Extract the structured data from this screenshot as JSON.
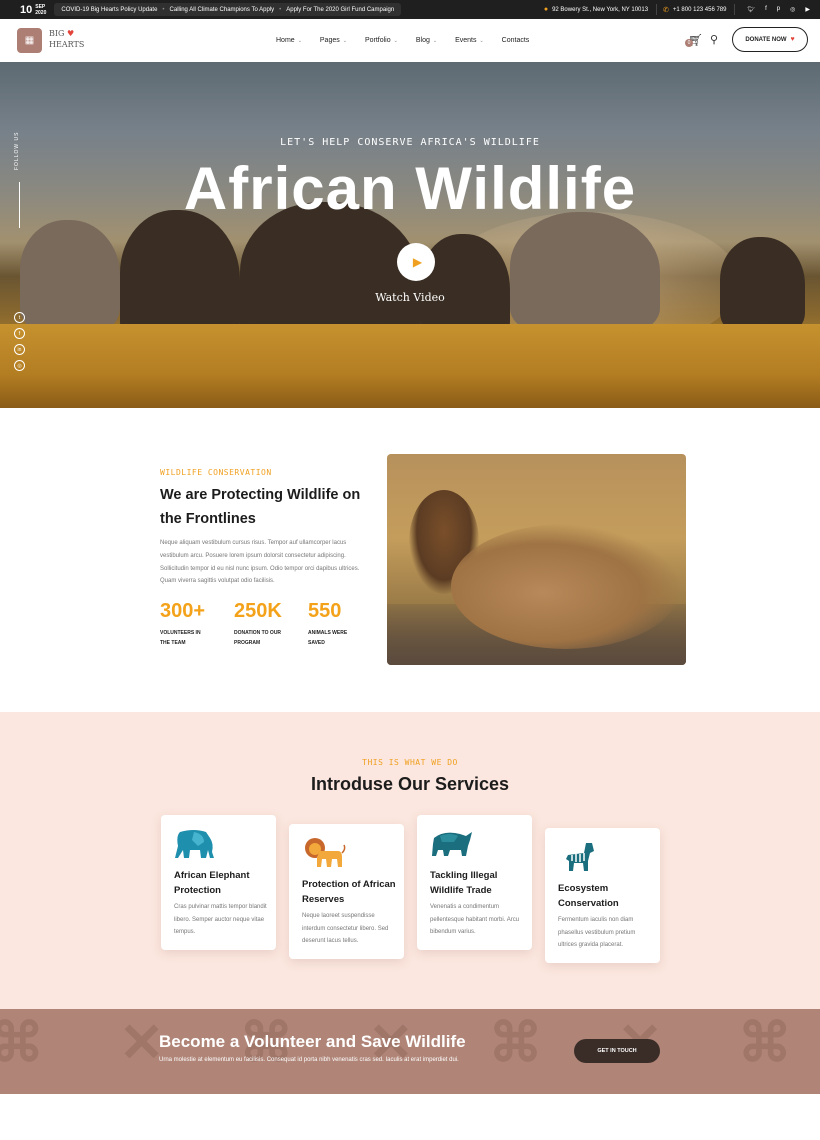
{
  "topbar": {
    "date_day": "10",
    "date_month": "SEP",
    "date_year": "2020",
    "news": [
      "COVID-19 Big Hearts Policy Update",
      "Calling All Climate Champions To Apply",
      "Apply For The 2020 Girl Fund Campaign"
    ],
    "address": "92 Bowery St., New York, NY 10013",
    "phone": "+1 800 123 456 789",
    "social_icons": [
      "twitter-icon",
      "facebook-icon",
      "pinterest-icon",
      "instagram-icon",
      "youtube-icon"
    ]
  },
  "header": {
    "logo_line1": "BIG",
    "logo_line2": "HEARTS",
    "nav": [
      {
        "label": "Home",
        "has_dropdown": true
      },
      {
        "label": "Pages",
        "has_dropdown": true
      },
      {
        "label": "Portfolio",
        "has_dropdown": true
      },
      {
        "label": "Blog",
        "has_dropdown": true
      },
      {
        "label": "Events",
        "has_dropdown": true
      },
      {
        "label": "Contacts",
        "has_dropdown": false
      }
    ],
    "cart_count": "0",
    "donate_label": "DONATE NOW"
  },
  "hero": {
    "subtitle": "LET'S HELP CONSERVE AFRICA'S WILDLIFE",
    "title": "African Wildlife",
    "watch_label": "Watch Video",
    "follow_label": "FOLLOW US",
    "follow_icons": [
      "twitter-icon",
      "facebook-icon",
      "linkedin-icon",
      "instagram-icon"
    ]
  },
  "about": {
    "subtitle": "WILDLIFE CONSERVATION",
    "title": "We are Protecting Wildlife on the Frontlines",
    "text": "Neque aliquam vestibulum cursus risus. Tempor auf ullamcorper lacus vestibulum arcu. Posuere lorem ipsum dolorsit consectetur adipiscing. Sollicitudin tempor id eu nisl nunc ipsum. Odio tempor orci dapibus ultrices. Quam viverra sagittis volutpat odio facilisis.",
    "stats": [
      {
        "number": "300+",
        "label": "VOLUNTEERS IN THE TEAM"
      },
      {
        "number": "250K",
        "label": "DONATION TO OUR PROGRAM"
      },
      {
        "number": "550",
        "label": "ANIMALS WERE SAVED"
      }
    ]
  },
  "services": {
    "subtitle": "THIS IS WHAT WE DO",
    "title": "Introduse Our Services",
    "cards": [
      {
        "icon": "elephant-icon",
        "title": "African Elephant Protection",
        "text": "Cras pulvinar mattis tempor blandit libero. Semper auctor neque vitae tempus."
      },
      {
        "icon": "lion-icon",
        "title": "Protection of African Reserves",
        "text": "Neque laoreet suspendisse interdum consectetur libero. Sed deserunt lacus tellus."
      },
      {
        "icon": "rhino-icon",
        "title": "Tackling Illegal Wildlife Trade",
        "text": "Venenatis a condimentum pellentesque habitant morbi. Arcu bibendum varius."
      },
      {
        "icon": "zebra-icon",
        "title": "Ecosystem Conservation",
        "text": "Fermentum iaculis non diam phasellus vestibulum pretium ultrices gravida placerat."
      }
    ]
  },
  "volunteer": {
    "title": "Become a Volunteer and Save Wildlife",
    "text": "Urna molestie at elementum eu facilisis. Consequat id porta nibh venenatis cras sed. Iaculis at erat imperdiet dui.",
    "button_label": "GET IN TOUCH"
  },
  "colors": {
    "accent": "#f3a21a",
    "brand_brown": "#ad7e74",
    "services_bg": "#fbe7df",
    "volunteer_bg": "#b08578",
    "dark": "#1f1f1f"
  }
}
